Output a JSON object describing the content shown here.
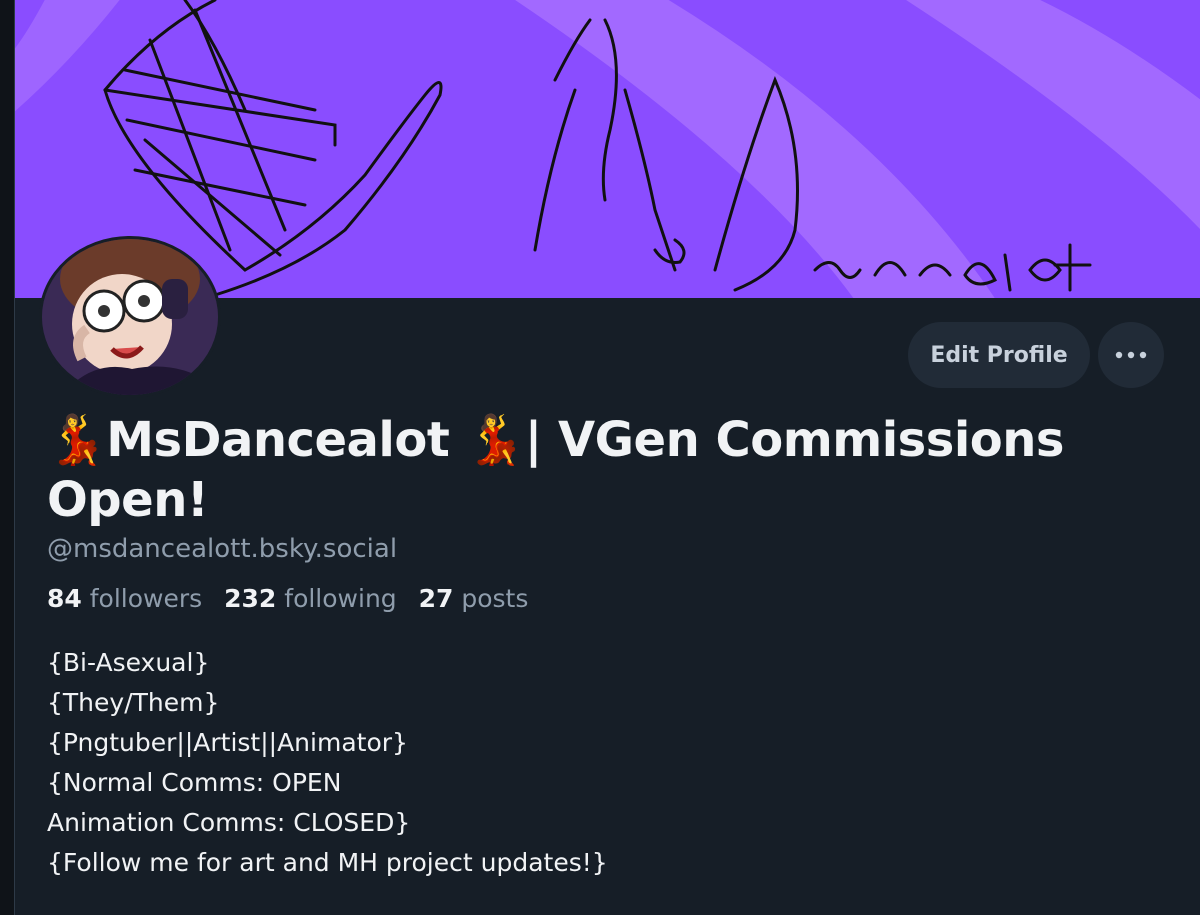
{
  "banner": {
    "accent": "#8a4dff",
    "stripe": "#b98cff"
  },
  "profile": {
    "display_name": "💃MsDancealot 💃| VGen Commissions Open!",
    "handle": "@msdancealott.bsky.social",
    "edit_label": "Edit Profile",
    "more_icon": "ellipsis-icon"
  },
  "stats": {
    "followers": {
      "count": "84",
      "label": "followers"
    },
    "following": {
      "count": "232",
      "label": "following"
    },
    "posts": {
      "count": "27",
      "label": "posts"
    }
  },
  "bio": [
    "{Bi-Asexual}",
    "{They/Them}",
    "{Pngtuber||Artist||Animator}",
    "{Normal Comms: OPEN",
    "Animation Comms: CLOSED}",
    "{Follow me for art and MH project updates!}"
  ],
  "colors": {
    "background": "#161e27",
    "button_bg": "#212b37",
    "text_primary": "#f1f3f5",
    "text_secondary": "#8f9dac"
  }
}
